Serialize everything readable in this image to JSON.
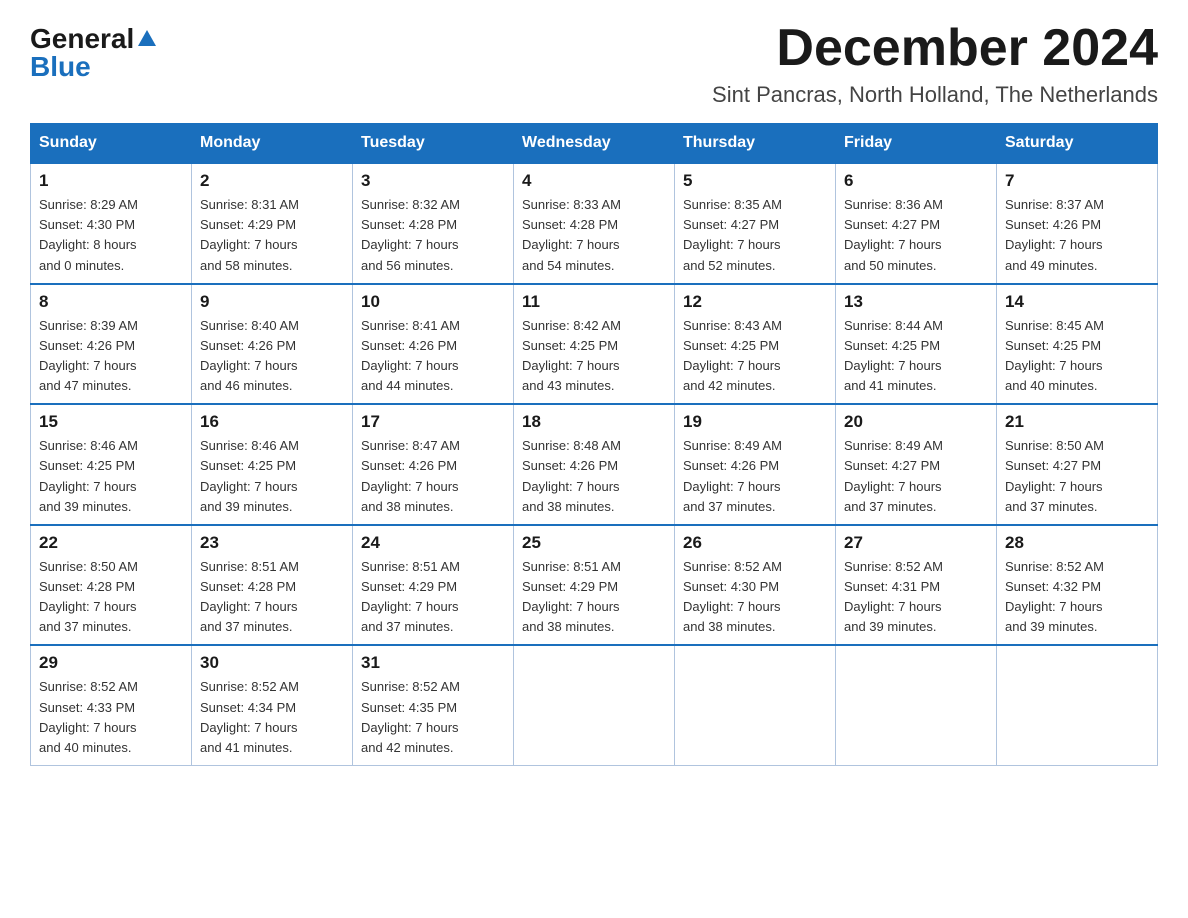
{
  "header": {
    "logo_general": "General",
    "logo_blue": "Blue",
    "month_title": "December 2024",
    "location": "Sint Pancras, North Holland, The Netherlands"
  },
  "days_of_week": [
    "Sunday",
    "Monday",
    "Tuesday",
    "Wednesday",
    "Thursday",
    "Friday",
    "Saturday"
  ],
  "weeks": [
    [
      {
        "day": "1",
        "sunrise": "8:29 AM",
        "sunset": "4:30 PM",
        "daylight": "8 hours and 0 minutes."
      },
      {
        "day": "2",
        "sunrise": "8:31 AM",
        "sunset": "4:29 PM",
        "daylight": "7 hours and 58 minutes."
      },
      {
        "day": "3",
        "sunrise": "8:32 AM",
        "sunset": "4:28 PM",
        "daylight": "7 hours and 56 minutes."
      },
      {
        "day": "4",
        "sunrise": "8:33 AM",
        "sunset": "4:28 PM",
        "daylight": "7 hours and 54 minutes."
      },
      {
        "day": "5",
        "sunrise": "8:35 AM",
        "sunset": "4:27 PM",
        "daylight": "7 hours and 52 minutes."
      },
      {
        "day": "6",
        "sunrise": "8:36 AM",
        "sunset": "4:27 PM",
        "daylight": "7 hours and 50 minutes."
      },
      {
        "day": "7",
        "sunrise": "8:37 AM",
        "sunset": "4:26 PM",
        "daylight": "7 hours and 49 minutes."
      }
    ],
    [
      {
        "day": "8",
        "sunrise": "8:39 AM",
        "sunset": "4:26 PM",
        "daylight": "7 hours and 47 minutes."
      },
      {
        "day": "9",
        "sunrise": "8:40 AM",
        "sunset": "4:26 PM",
        "daylight": "7 hours and 46 minutes."
      },
      {
        "day": "10",
        "sunrise": "8:41 AM",
        "sunset": "4:26 PM",
        "daylight": "7 hours and 44 minutes."
      },
      {
        "day": "11",
        "sunrise": "8:42 AM",
        "sunset": "4:25 PM",
        "daylight": "7 hours and 43 minutes."
      },
      {
        "day": "12",
        "sunrise": "8:43 AM",
        "sunset": "4:25 PM",
        "daylight": "7 hours and 42 minutes."
      },
      {
        "day": "13",
        "sunrise": "8:44 AM",
        "sunset": "4:25 PM",
        "daylight": "7 hours and 41 minutes."
      },
      {
        "day": "14",
        "sunrise": "8:45 AM",
        "sunset": "4:25 PM",
        "daylight": "7 hours and 40 minutes."
      }
    ],
    [
      {
        "day": "15",
        "sunrise": "8:46 AM",
        "sunset": "4:25 PM",
        "daylight": "7 hours and 39 minutes."
      },
      {
        "day": "16",
        "sunrise": "8:46 AM",
        "sunset": "4:25 PM",
        "daylight": "7 hours and 39 minutes."
      },
      {
        "day": "17",
        "sunrise": "8:47 AM",
        "sunset": "4:26 PM",
        "daylight": "7 hours and 38 minutes."
      },
      {
        "day": "18",
        "sunrise": "8:48 AM",
        "sunset": "4:26 PM",
        "daylight": "7 hours and 38 minutes."
      },
      {
        "day": "19",
        "sunrise": "8:49 AM",
        "sunset": "4:26 PM",
        "daylight": "7 hours and 37 minutes."
      },
      {
        "day": "20",
        "sunrise": "8:49 AM",
        "sunset": "4:27 PM",
        "daylight": "7 hours and 37 minutes."
      },
      {
        "day": "21",
        "sunrise": "8:50 AM",
        "sunset": "4:27 PM",
        "daylight": "7 hours and 37 minutes."
      }
    ],
    [
      {
        "day": "22",
        "sunrise": "8:50 AM",
        "sunset": "4:28 PM",
        "daylight": "7 hours and 37 minutes."
      },
      {
        "day": "23",
        "sunrise": "8:51 AM",
        "sunset": "4:28 PM",
        "daylight": "7 hours and 37 minutes."
      },
      {
        "day": "24",
        "sunrise": "8:51 AM",
        "sunset": "4:29 PM",
        "daylight": "7 hours and 37 minutes."
      },
      {
        "day": "25",
        "sunrise": "8:51 AM",
        "sunset": "4:29 PM",
        "daylight": "7 hours and 38 minutes."
      },
      {
        "day": "26",
        "sunrise": "8:52 AM",
        "sunset": "4:30 PM",
        "daylight": "7 hours and 38 minutes."
      },
      {
        "day": "27",
        "sunrise": "8:52 AM",
        "sunset": "4:31 PM",
        "daylight": "7 hours and 39 minutes."
      },
      {
        "day": "28",
        "sunrise": "8:52 AM",
        "sunset": "4:32 PM",
        "daylight": "7 hours and 39 minutes."
      }
    ],
    [
      {
        "day": "29",
        "sunrise": "8:52 AM",
        "sunset": "4:33 PM",
        "daylight": "7 hours and 40 minutes."
      },
      {
        "day": "30",
        "sunrise": "8:52 AM",
        "sunset": "4:34 PM",
        "daylight": "7 hours and 41 minutes."
      },
      {
        "day": "31",
        "sunrise": "8:52 AM",
        "sunset": "4:35 PM",
        "daylight": "7 hours and 42 minutes."
      },
      null,
      null,
      null,
      null
    ]
  ],
  "labels": {
    "sunrise": "Sunrise:",
    "sunset": "Sunset:",
    "daylight": "Daylight:"
  }
}
